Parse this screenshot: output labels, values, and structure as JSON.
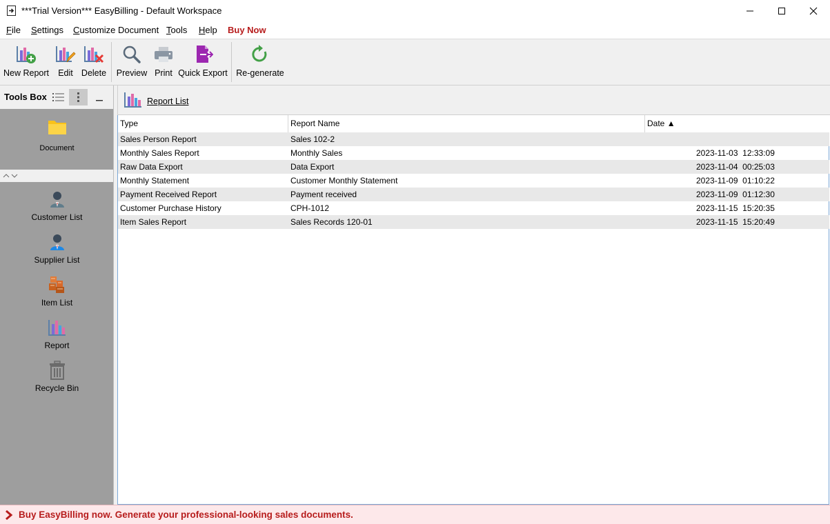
{
  "window": {
    "title": "***Trial Version*** EasyBilling - Default Workspace"
  },
  "menu": {
    "file": {
      "first": "F",
      "rest": "ile"
    },
    "settings": {
      "first": "S",
      "rest": "ettings"
    },
    "customize": {
      "first": "C",
      "rest": "ustomize Document"
    },
    "tools": {
      "first": "T",
      "rest": "ools"
    },
    "help": {
      "first": "H",
      "rest": "elp"
    },
    "buy": "Buy Now"
  },
  "toolbar": {
    "new_report": "New Report",
    "edit": "Edit",
    "delete": "Delete",
    "preview": "Preview",
    "print": "Print",
    "quick_export": "Quick Export",
    "regenerate": "Re-generate"
  },
  "toolsbox": {
    "title": "Tools Box",
    "document": "Document",
    "nav": [
      {
        "label": "Customer List",
        "icon": "customer-icon"
      },
      {
        "label": "Supplier List",
        "icon": "supplier-icon"
      },
      {
        "label": "Item List",
        "icon": "item-icon"
      },
      {
        "label": "Report",
        "icon": "report-icon"
      },
      {
        "label": "Recycle Bin",
        "icon": "recycle-bin-icon"
      }
    ]
  },
  "main": {
    "header": "Report List",
    "columns": [
      "Type",
      "Report Name",
      "Date"
    ],
    "sort_indicator": "▲",
    "rows": [
      {
        "type": "Sales Person Report",
        "name": "Sales 102-2",
        "date": ""
      },
      {
        "type": "Monthly Sales Report",
        "name": "Monthly Sales",
        "date": "2023-11-03  12:33:09"
      },
      {
        "type": "Raw Data Export",
        "name": "Data Export",
        "date": "2023-11-04  00:25:03"
      },
      {
        "type": "Monthly Statement",
        "name": "Customer Monthly Statement",
        "date": "2023-11-09  01:10:22"
      },
      {
        "type": "Payment Received Report",
        "name": "Payment received",
        "date": "2023-11-09  01:12:30"
      },
      {
        "type": "Customer Purchase History",
        "name": "CPH-1012",
        "date": "2023-11-15  15:20:35"
      },
      {
        "type": "Item Sales Report",
        "name": "Sales Records 120-01",
        "date": "2023-11-15  15:20:49"
      }
    ]
  },
  "status": {
    "message": "Buy EasyBilling now. Generate your professional-looking sales documents."
  },
  "colors": {
    "accent_red": "#b71c1c",
    "panel_gray": "#9e9e9e",
    "row_alt": "#e8e8e8"
  }
}
